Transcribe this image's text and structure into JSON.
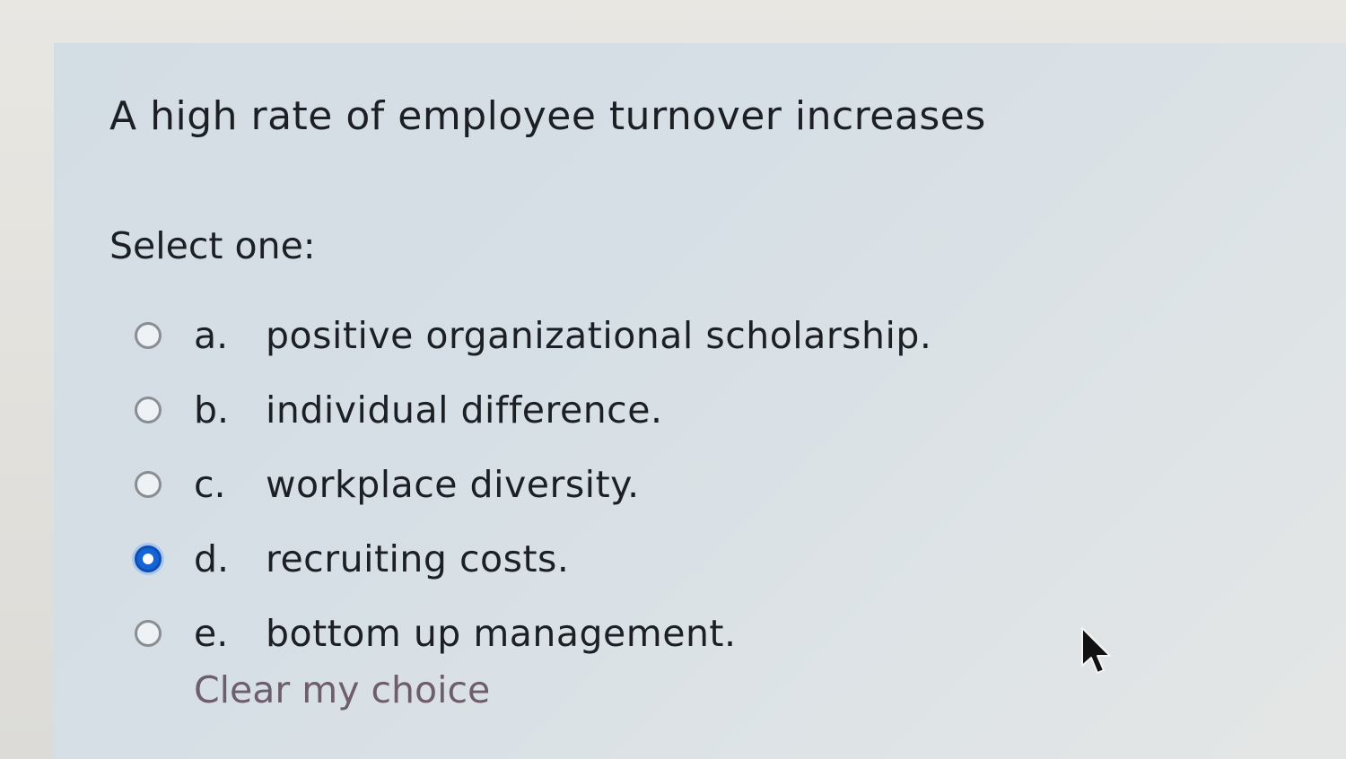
{
  "question": {
    "text": "A high rate of employee turnover increases",
    "prompt": "Select one:"
  },
  "options": [
    {
      "letter": "a.",
      "text": "positive organizational scholarship.",
      "selected": false
    },
    {
      "letter": "b.",
      "text": "individual difference.",
      "selected": false
    },
    {
      "letter": "c.",
      "text": "workplace diversity.",
      "selected": false
    },
    {
      "letter": "d.",
      "text": "recruiting costs.",
      "selected": true
    },
    {
      "letter": "e.",
      "text": "bottom up management.",
      "selected": false
    }
  ],
  "clear_choice": {
    "label": "Clear my choice"
  },
  "colors": {
    "selected_radio": "#1464d8",
    "clear_link": "#6e5d6d"
  },
  "icons": {
    "pointer": "mouse-pointer-icon"
  }
}
